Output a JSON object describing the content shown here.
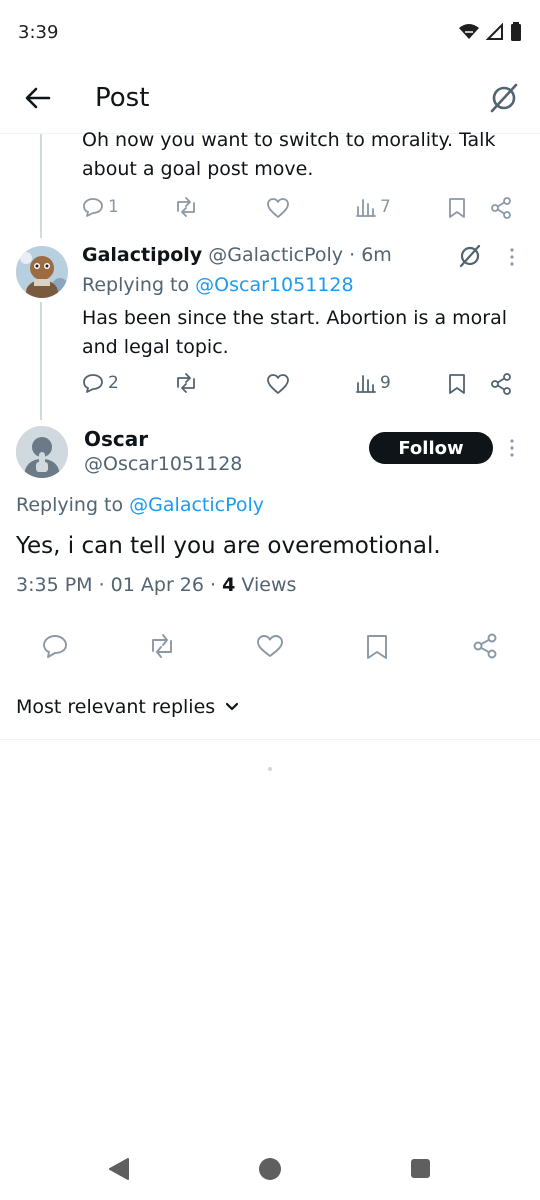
{
  "status_bar": {
    "time": "3:39"
  },
  "header": {
    "title": "Post"
  },
  "prev_reply": {
    "text": "Oh now you want to switch to morality. Talk about a goal post move.",
    "replies": "1",
    "views": "7"
  },
  "reply": {
    "name": "Galactipoly",
    "handle": "@GalacticPoly",
    "time": "· 6m",
    "replying_prefix": "Replying to",
    "replying_to": "@Oscar1051128",
    "text": "Has been since the start. Abortion is a moral and legal topic.",
    "replies": "2",
    "views": "9"
  },
  "main_post": {
    "name": "Oscar",
    "handle": "@Oscar1051128",
    "follow_label": "Follow",
    "replying_prefix": "Replying to",
    "replying_to": "@GalacticPoly",
    "text": "Yes,  i can tell you are overemotional.",
    "timestamp": "3:35 PM · 01 Apr 26 ·",
    "views_count": "4",
    "views_label": "Views"
  },
  "sort": {
    "label": "Most relevant replies"
  },
  "colors": {
    "accent": "#1d9bf0",
    "text": "#0f1419",
    "muted": "#536471"
  }
}
